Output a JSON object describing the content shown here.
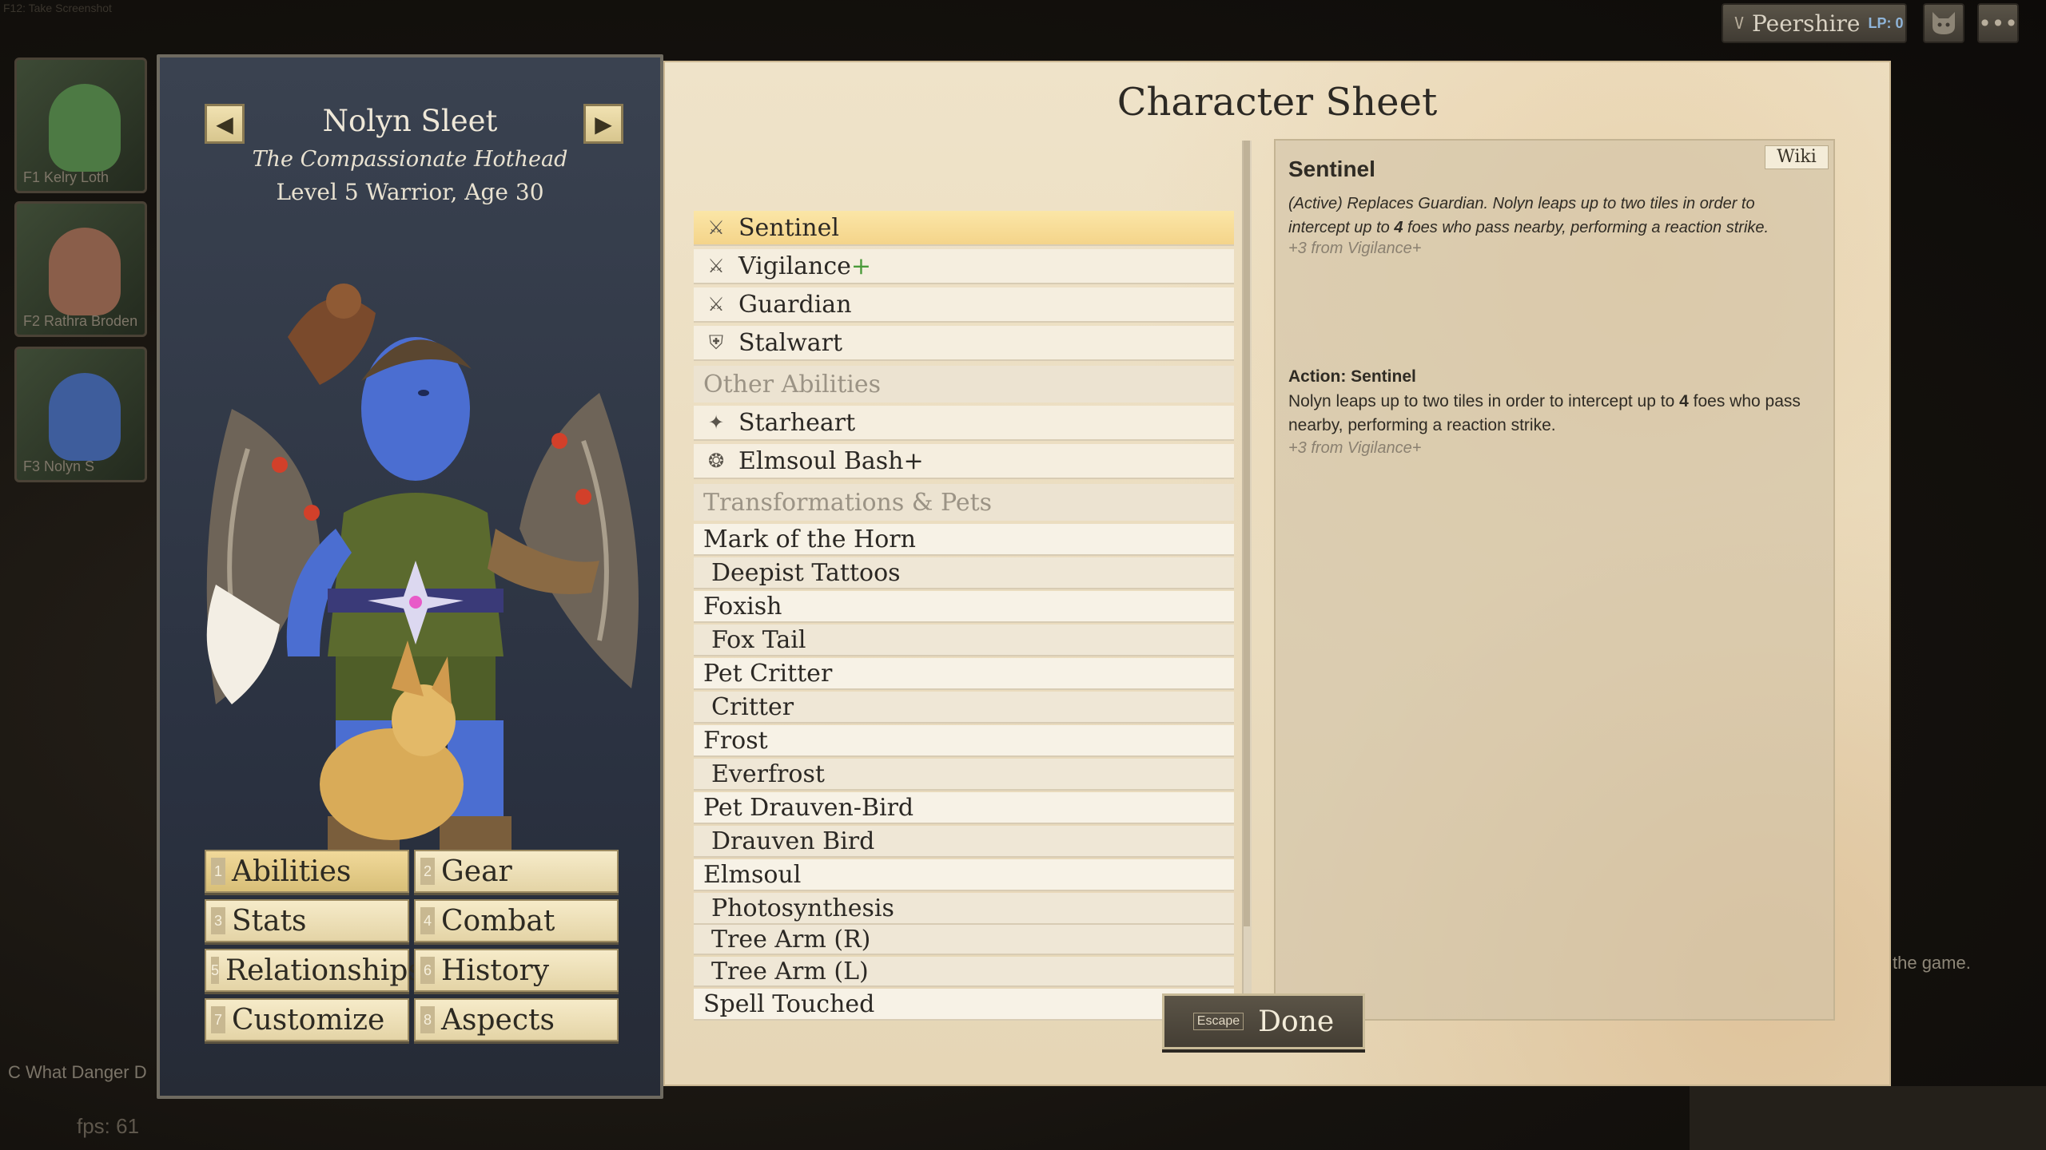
{
  "hud": {
    "screenshot_hint": "F12: Take Screenshot",
    "town_key": "V",
    "town_name": "Peershire",
    "lp_label": "LP: 0",
    "more_label": "•••"
  },
  "party": [
    {
      "label": "F1 Kelry Loth"
    },
    {
      "label": "F2 Rathra Broden"
    },
    {
      "label": "F3 Nolyn S"
    }
  ],
  "footer": {
    "quest_hint": "C What Danger D",
    "fps": "fps: 61",
    "side_note": "the game."
  },
  "character": {
    "name": "Nolyn Sleet",
    "title": "The Compassionate Hothead",
    "level_line": "Level 5 Warrior, Age 30",
    "prev_arrow": "◀",
    "next_arrow": "▶"
  },
  "tabs": [
    {
      "num": "1",
      "label": "Abilities",
      "active": true
    },
    {
      "num": "2",
      "label": "Gear"
    },
    {
      "num": "3",
      "label": "Stats"
    },
    {
      "num": "4",
      "label": "Combat"
    },
    {
      "num": "5",
      "label": "Relationships"
    },
    {
      "num": "6",
      "label": "History"
    },
    {
      "num": "7",
      "label": "Customize"
    },
    {
      "num": "8",
      "label": "Aspects"
    }
  ],
  "sheet": {
    "title": "Character Sheet",
    "abilities": [
      {
        "label": "Sentinel",
        "icon": "sword-eye-icon",
        "selected": true
      },
      {
        "label": "Vigilance",
        "plus": "+",
        "icon": "sword-star-icon"
      },
      {
        "label": "Guardian",
        "icon": "sword-eye-icon"
      },
      {
        "label": "Stalwart",
        "icon": "shield-icon"
      }
    ],
    "other_header": "Other Abilities",
    "other_abilities": [
      {
        "label": "Starheart",
        "icon": "star-sparkle-icon"
      },
      {
        "label": "Elmsoul Bash+",
        "icon": "spiral-bash-icon"
      }
    ],
    "transform_header": "Transformations & Pets",
    "transformations": [
      {
        "label": "Mark of the Horn",
        "sub": false
      },
      {
        "label": "Deepist Tattoos",
        "sub": true
      },
      {
        "label": "Foxish",
        "sub": false
      },
      {
        "label": "Fox Tail",
        "sub": true
      },
      {
        "label": "Pet Critter",
        "sub": false
      },
      {
        "label": "Critter",
        "sub": true
      },
      {
        "label": "Frost",
        "sub": false
      },
      {
        "label": "Everfrost",
        "sub": true
      },
      {
        "label": "Pet Drauven-Bird",
        "sub": false
      },
      {
        "label": "Drauven Bird",
        "sub": true
      },
      {
        "label": "Elmsoul",
        "sub": false
      },
      {
        "label": "Photosynthesis",
        "sub": true
      },
      {
        "label": "Tree Arm (R)",
        "sub": true
      },
      {
        "label": "Tree Arm (L)",
        "sub": true
      },
      {
        "label": "Spell Touched",
        "sub": false
      }
    ]
  },
  "detail": {
    "wiki": "Wiki",
    "name": "Sentinel",
    "desc_pre": "(Active) Replaces Guardian. Nolyn leaps up to two tiles in order to intercept up to ",
    "desc_num": "4",
    "desc_post": " foes who pass nearby, performing a reaction strike.",
    "from1": "+3 from Vigilance+",
    "action_title": "Action: Sentinel",
    "action_pre": "Nolyn leaps up to two tiles in order to intercept up to ",
    "action_num": "4",
    "action_post": " foes who pass nearby, performing a reaction strike.",
    "from2": "+3 from Vigilance+"
  },
  "done": {
    "key": "Escape",
    "label": "Done"
  },
  "colors": {
    "accent": "#f4d48a",
    "plus_green": "#4a9a3a",
    "panel_blue": "#2a3140"
  }
}
